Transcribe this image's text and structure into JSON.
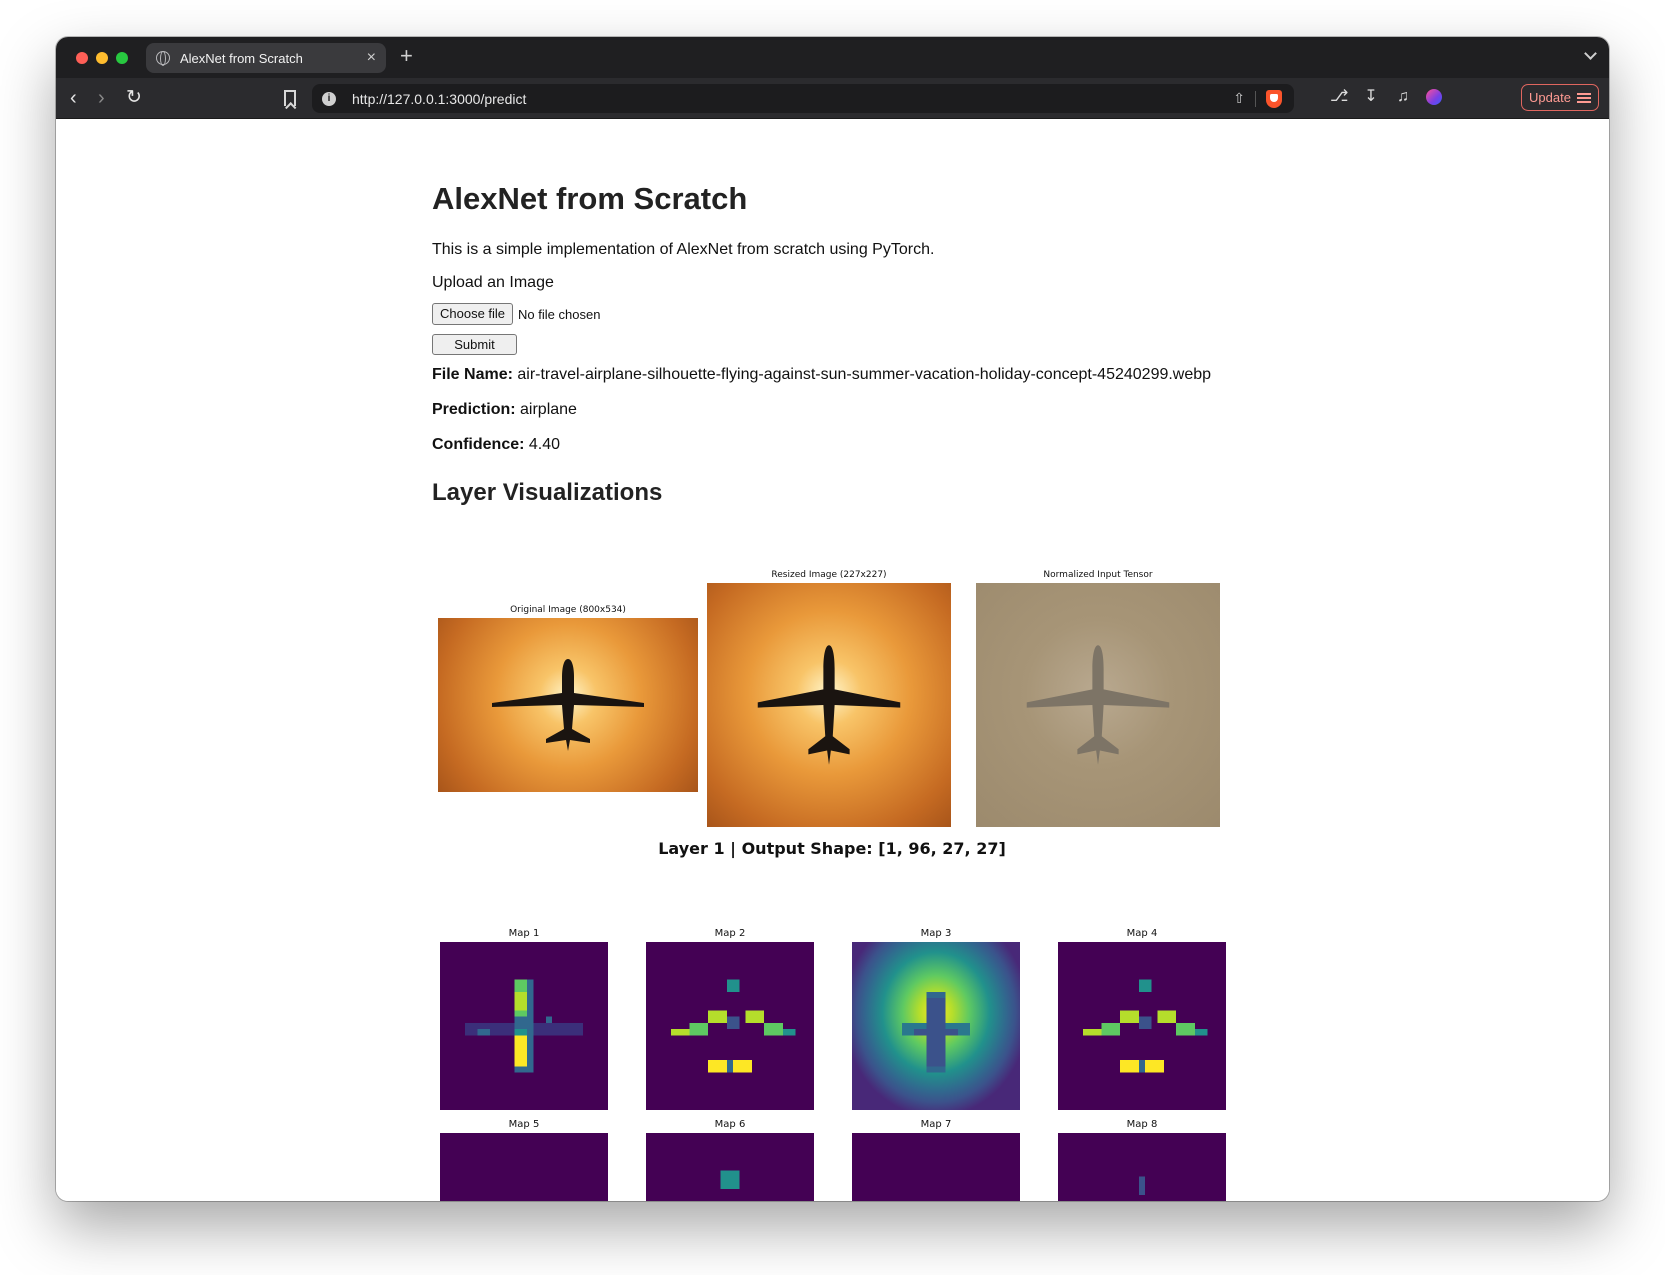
{
  "browser": {
    "tab_title": "AlexNet from Scratch",
    "tab_close": "×",
    "new_tab": "+",
    "url": "http://127.0.0.1:3000/predict",
    "update_label": "Update"
  },
  "page": {
    "title": "AlexNet from Scratch",
    "intro": "This is a simple implementation of AlexNet from scratch using PyTorch.",
    "upload_label": "Upload an Image",
    "choose_file_label": "Choose file",
    "no_file_text": "No file chosen",
    "submit_label": "Submit",
    "file_name_label": "File Name:",
    "file_name_value": "air-travel-airplane-silhouette-flying-against-sun-summer-vacation-holiday-concept-45240299.webp",
    "prediction_label": "Prediction:",
    "prediction_value": "airplane",
    "confidence_label": "Confidence:",
    "confidence_value": "4.40",
    "visualizations_heading": "Layer Visualizations"
  },
  "input_figure": {
    "captions": [
      "Original Image (800x534)",
      "Resized Image (227x227)",
      "Normalized Input Tensor"
    ]
  },
  "layer": {
    "title": "Layer 1 | Output Shape: [1, 96, 27, 27]",
    "maps": [
      "Map 1",
      "Map 2",
      "Map 3",
      "Map 4",
      "Map 5",
      "Map 6",
      "Map 7",
      "Map 8"
    ]
  },
  "colors": {
    "viridis_dark": "#440154",
    "viridis_yellow": "#fde725",
    "viridis_green": "#5ec962",
    "viridis_teal": "#21918c",
    "update_accent": "#e0665f"
  }
}
